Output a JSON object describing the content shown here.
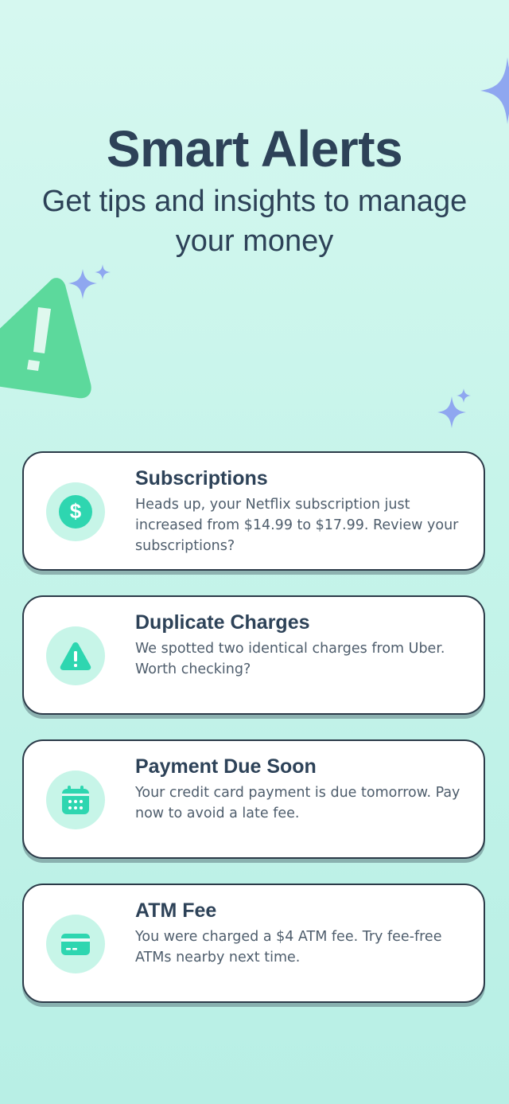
{
  "header": {
    "title": "Smart Alerts",
    "subtitle": "Get tips and insights to manage your money"
  },
  "colors": {
    "background_top": "#d6f8f0",
    "background_bottom": "#b8efe5",
    "text_dark": "#2d4258",
    "accent_green": "#2ed6b0",
    "icon_circle": "#c7f5e8",
    "sparkle_purple": "#8fa7f0",
    "warning_green": "#5cd99c"
  },
  "decorations": [
    "sparkle-icon",
    "warning-triangle-icon"
  ],
  "alerts": [
    {
      "icon": "dollar-icon",
      "title": "Subscriptions",
      "body": "Heads up, your Netflix subscription just increased from $14.99 to $17.99. Review your subscriptions?"
    },
    {
      "icon": "warning-icon",
      "title": "Duplicate Charges",
      "body": "We spotted two identical charges from Uber. Worth checking?"
    },
    {
      "icon": "calendar-icon",
      "title": "Payment Due Soon",
      "body": "Your credit card payment is due tomorrow. Pay now to avoid a late fee."
    },
    {
      "icon": "credit-card-icon",
      "title": "ATM Fee",
      "body": "You were charged a $4 ATM fee. Try fee-free ATMs nearby next time."
    }
  ]
}
